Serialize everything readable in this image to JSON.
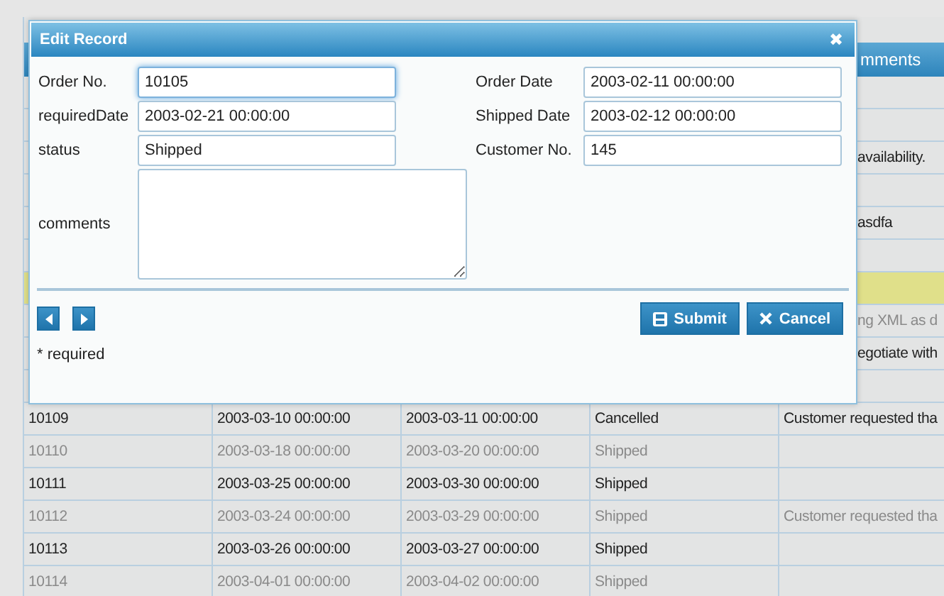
{
  "grid": {
    "header_fragment": "mments",
    "covered_rows": [
      {
        "comments": ""
      },
      {
        "comments": ""
      },
      {
        "comments": "availability.",
        "dimmed": false,
        "highlighted": false
      },
      {
        "comments": ""
      },
      {
        "comments": "asdfa",
        "dimmed": false,
        "highlighted": false
      },
      {
        "comments": ""
      },
      {
        "comments": "",
        "dimmed": false,
        "highlighted": true
      },
      {
        "comments": "ng XML as d",
        "dimmed": true,
        "highlighted": false
      },
      {
        "comments": "egotiate with",
        "dimmed": false,
        "highlighted": false
      },
      {
        "comments": ""
      }
    ],
    "rows": [
      {
        "cells": [
          "10109",
          "2003-03-10 00:00:00",
          "2003-03-11 00:00:00",
          "Cancelled",
          "Customer requested tha"
        ],
        "dimmed": false
      },
      {
        "cells": [
          "10110",
          "2003-03-18 00:00:00",
          "2003-03-20 00:00:00",
          "Shipped",
          ""
        ],
        "dimmed": true
      },
      {
        "cells": [
          "10111",
          "2003-03-25 00:00:00",
          "2003-03-30 00:00:00",
          "Shipped",
          ""
        ],
        "dimmed": false
      },
      {
        "cells": [
          "10112",
          "2003-03-24 00:00:00",
          "2003-03-29 00:00:00",
          "Shipped",
          "Customer requested tha"
        ],
        "dimmed": true
      },
      {
        "cells": [
          "10113",
          "2003-03-26 00:00:00",
          "2003-03-27 00:00:00",
          "Shipped",
          ""
        ],
        "dimmed": false
      },
      {
        "cells": [
          "10114",
          "2003-04-01 00:00:00",
          "2003-04-02 00:00:00",
          "Shipped",
          ""
        ],
        "dimmed": true
      }
    ]
  },
  "dialog": {
    "title": "Edit Record",
    "close": "✖",
    "left_fields": [
      {
        "label": "Order No.",
        "value": "10105",
        "focused": true
      },
      {
        "label": "requiredDate",
        "value": "2003-02-21 00:00:00",
        "focused": false
      },
      {
        "label": "status",
        "value": "Shipped",
        "focused": false
      }
    ],
    "right_fields": [
      {
        "label": "Order Date",
        "value": "2003-02-11 00:00:00",
        "focused": false
      },
      {
        "label": "Shipped Date",
        "value": "2003-02-12 00:00:00",
        "focused": false
      },
      {
        "label": "Customer No.",
        "value": "145",
        "focused": false
      }
    ],
    "comments": {
      "label": "comments"
    },
    "buttons": [
      "Submit",
      "Cancel"
    ],
    "note": "* required"
  }
}
